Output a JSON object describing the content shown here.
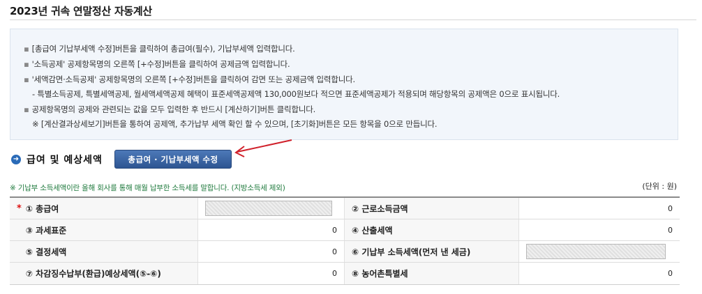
{
  "page": {
    "title": "2023년 귀속 연말정산 자동계산"
  },
  "notice": {
    "lines": [
      "[총급여 기납부세액 수정]버튼을 클릭하여 총급여(필수), 기납부세액 입력합니다.",
      "'소득공제' 공제항목명의 오른쪽 [+수정]버튼을 클릭하여 공제금액 입력합니다.",
      "'세액감면·소득공제' 공제항목명의 오른쪽 [+수정]버튼을 클릭하여 감면 또는 공제금액 입력합니다.",
      "- 특별소득공제, 특별세액공제, 월세액세액공제 혜택이 표준세액공제액 130,000원보다 적으면 표준세액공제가 적용되며 해당항목의 공제액은 0으로 표시됩니다.",
      "공제항목명의 공제와 관련되는 값을 모두 입력한 후 반드시 [계산하기]버튼 클릭합니다.",
      "※ [계산결과상세보기]버튼을 통하여 공제액, 추가납부 세액 확인 할 수 있으며, [초기화]버튼은 모든 항목을 0으로 만듭니다."
    ]
  },
  "section": {
    "title": "급여 및 예상세액",
    "edit_button": "총급여 · 기납부세액 수정"
  },
  "note": "※ 기납부 소득세액이란 올해 회사를 통해 매월 납부한 소득세를 말합니다. (지방소득세 제외)",
  "unit": "(단위 : 원)",
  "rows": [
    {
      "left_label": "① 총급여",
      "left_required": true,
      "left_value": "",
      "right_label": "② 근로소득금액",
      "right_value": "0"
    },
    {
      "left_label": "③ 과세표준",
      "left_required": false,
      "left_value": "0",
      "right_label": "④ 산출세액",
      "right_value": "0"
    },
    {
      "left_label": "⑤ 결정세액",
      "left_required": false,
      "left_value": "0",
      "right_label": "⑥ 기납부 소득세액(먼저 낸 세금)",
      "right_value": ""
    },
    {
      "left_label": "⑦ 차감징수납부(환급)예상세액(⑤-⑥)",
      "left_required": false,
      "left_value": "0",
      "right_label": "⑧ 농어촌특별세",
      "right_value": "0"
    }
  ],
  "required_mark": "*",
  "colors": {
    "accent": "#2d5592",
    "arrow": "#d0202a",
    "note": "#1f7a3d"
  }
}
